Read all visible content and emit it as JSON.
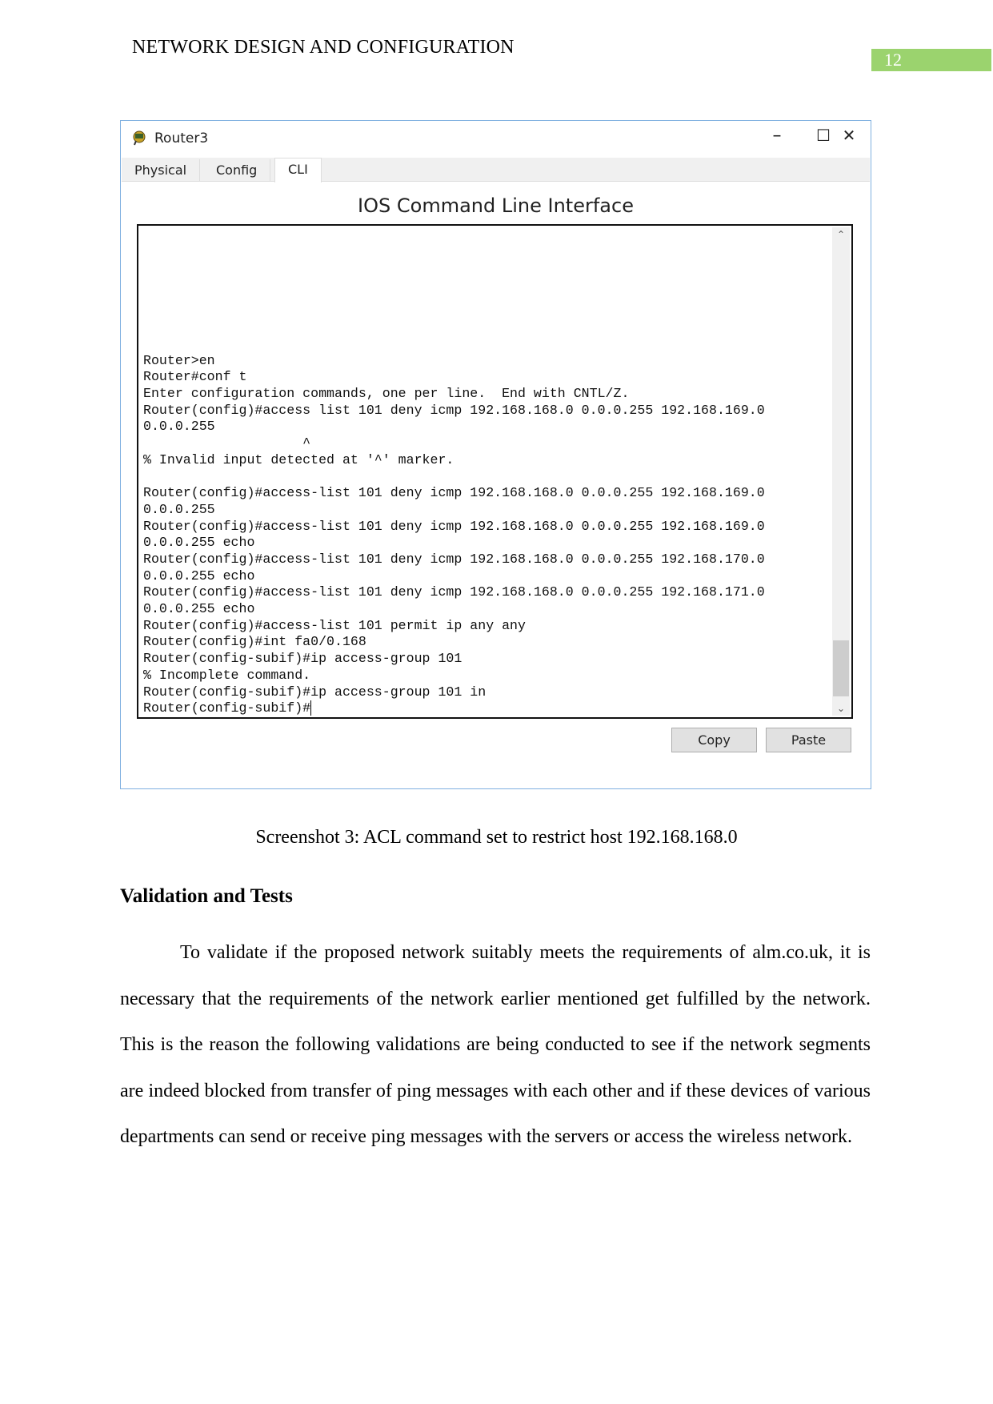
{
  "header": {
    "title": "NETWORK DESIGN AND CONFIGURATION",
    "page_number": "12",
    "accent_color": "#9bd36e"
  },
  "window": {
    "title": "Router3",
    "icon": "router-icon",
    "controls": {
      "minimize": "–",
      "maximize": "☐",
      "close": "✕"
    },
    "tabs": [
      {
        "label": "Physical"
      },
      {
        "label": "Config"
      },
      {
        "label": "CLI",
        "active": true
      }
    ],
    "cli_title": "IOS Command Line Interface",
    "terminal_lines": [
      "Router>en",
      "Router#conf t",
      "Enter configuration commands, one per line.  End with CNTL/Z.",
      "Router(config)#access list 101 deny icmp 192.168.168.0 0.0.0.255 192.168.169.0",
      "0.0.0.255",
      "                    ^",
      "% Invalid input detected at '^' marker.",
      "",
      "Router(config)#access-list 101 deny icmp 192.168.168.0 0.0.0.255 192.168.169.0",
      "0.0.0.255",
      "Router(config)#access-list 101 deny icmp 192.168.168.0 0.0.0.255 192.168.169.0",
      "0.0.0.255 echo",
      "Router(config)#access-list 101 deny icmp 192.168.168.0 0.0.0.255 192.168.170.0",
      "0.0.0.255 echo",
      "Router(config)#access-list 101 deny icmp 192.168.168.0 0.0.0.255 192.168.171.0",
      "0.0.0.255 echo",
      "Router(config)#access-list 101 permit ip any any",
      "Router(config)#int fa0/0.168",
      "Router(config-subif)#ip access-group 101",
      "% Incomplete command.",
      "Router(config-subif)#ip access-group 101 in",
      "Router(config-subif)#"
    ],
    "copy_label": "Copy",
    "paste_label": "Paste"
  },
  "caption": "Screenshot 3: ACL command set to restrict host 192.168.168.0",
  "section_heading": "Validation and Tests",
  "paragraph": "To validate if the proposed network suitably meets the requirements of alm.co.uk, it is necessary that the requirements of the network earlier mentioned get fulfilled by the network. This is the reason the following validations are being conducted to see if the network segments are indeed blocked from transfer of ping messages with each other and if these devices of various departments can send or receive ping messages with the servers or access the wireless network."
}
